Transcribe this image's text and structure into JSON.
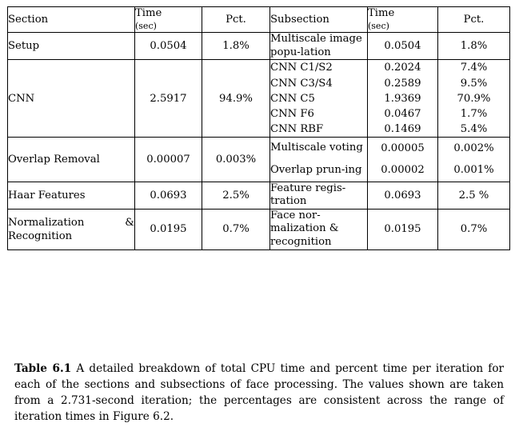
{
  "table": {
    "headers": {
      "left": {
        "section": "Section",
        "time": "Time",
        "time_unit": "(sec)",
        "pct": "Pct."
      },
      "right": {
        "subsection": "Subsection",
        "time": "Time",
        "time_unit": "(sec)",
        "pct": "Pct."
      }
    },
    "rows": [
      {
        "section": "Setup",
        "section_time": "0.0504",
        "section_pct": "1.8%",
        "subsections": [
          {
            "name": "Multiscale image popu-lation",
            "time": "0.0504",
            "pct": "1.8%"
          }
        ]
      },
      {
        "section": "CNN",
        "section_time": "2.5917",
        "section_pct": "94.9%",
        "subsections": [
          {
            "name": "CNN C1/S2",
            "time": "0.2024",
            "pct": "7.4%"
          },
          {
            "name": "CNN C3/S4",
            "time": "0.2589",
            "pct": "9.5%"
          },
          {
            "name": "CNN C5",
            "time": "1.9369",
            "pct": "70.9%"
          },
          {
            "name": "CNN F6",
            "time": "0.0467",
            "pct": "1.7%"
          },
          {
            "name": "CNN RBF",
            "time": "0.1469",
            "pct": "5.4%"
          }
        ]
      },
      {
        "section": "Overlap Removal",
        "section_time": "0.00007",
        "section_pct": "0.003%",
        "subsections": [
          {
            "name": "Multiscale voting",
            "time": "0.00005",
            "pct": "0.002%"
          },
          {
            "name": "Overlap prun-ing",
            "time": "0.00002",
            "pct": "0.001%"
          }
        ]
      },
      {
        "section": "Haar Features",
        "section_time": "0.0693",
        "section_pct": "2.5%",
        "subsections": [
          {
            "name": "Feature regis-tration",
            "time": "0.0693",
            "pct": "2.5 %"
          }
        ]
      },
      {
        "section": "Normalization & Recognition",
        "section_time": "0.0195",
        "section_pct": "0.7%",
        "subsections": [
          {
            "name": "Face nor-malization & recognition",
            "time": "0.0195",
            "pct": "0.7%"
          }
        ]
      }
    ]
  },
  "caption": {
    "lead": "Table 6.1",
    "body": "A detailed breakdown of total CPU time and percent time per iteration for each of the sections and subsections of face processing. The values shown are taken from a 2.731-second iteration; the percentages are consistent across the range of iteration times in Figure 6.2."
  }
}
